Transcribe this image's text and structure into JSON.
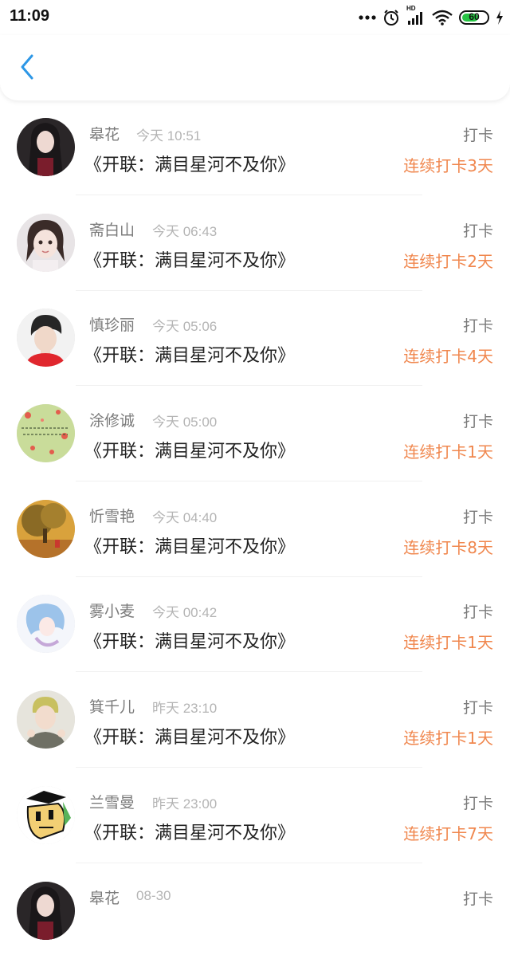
{
  "status_bar": {
    "time": "11:09",
    "battery": "60",
    "network": "HD",
    "icons": [
      "more-dots-icon",
      "alarm-icon",
      "signal-icon",
      "wifi-icon",
      "battery-icon",
      "charging-icon"
    ]
  },
  "header": {
    "back_icon": "chevron-left-icon",
    "accent_color": "#2d97e6"
  },
  "colors": {
    "streak": "#f0874e",
    "name": "#7a7a7a",
    "time": "#b4b4b4",
    "title": "#222222"
  },
  "rows": [
    {
      "name": "皋花",
      "time": "今天 10:51",
      "title": "《开联：满目星河不及你》",
      "type": "打卡",
      "streak": "连续打卡3天"
    },
    {
      "name": "斋白山",
      "time": "今天 06:43",
      "title": "《开联：满目星河不及你》",
      "type": "打卡",
      "streak": "连续打卡2天"
    },
    {
      "name": "慎珍丽",
      "time": "今天 05:06",
      "title": "《开联：满目星河不及你》",
      "type": "打卡",
      "streak": "连续打卡4天"
    },
    {
      "name": "涂修诚",
      "time": "今天 05:00",
      "title": "《开联：满目星河不及你》",
      "type": "打卡",
      "streak": "连续打卡1天"
    },
    {
      "name": "忻雪艳",
      "time": "今天 04:40",
      "title": "《开联：满目星河不及你》",
      "type": "打卡",
      "streak": "连续打卡8天"
    },
    {
      "name": "雾小麦",
      "time": "今天 00:42",
      "title": "《开联：满目星河不及你》",
      "type": "打卡",
      "streak": "连续打卡1天"
    },
    {
      "name": "箕千儿",
      "time": "昨天 23:10",
      "title": "《开联：满目星河不及你》",
      "type": "打卡",
      "streak": "连续打卡1天"
    },
    {
      "name": "兰雪曼",
      "time": "昨天 23:00",
      "title": "《开联：满目星河不及你》",
      "type": "打卡",
      "streak": "连续打卡7天"
    },
    {
      "name": "皋花",
      "time": "08-30",
      "title": "",
      "type": "打卡",
      "streak": ""
    }
  ]
}
